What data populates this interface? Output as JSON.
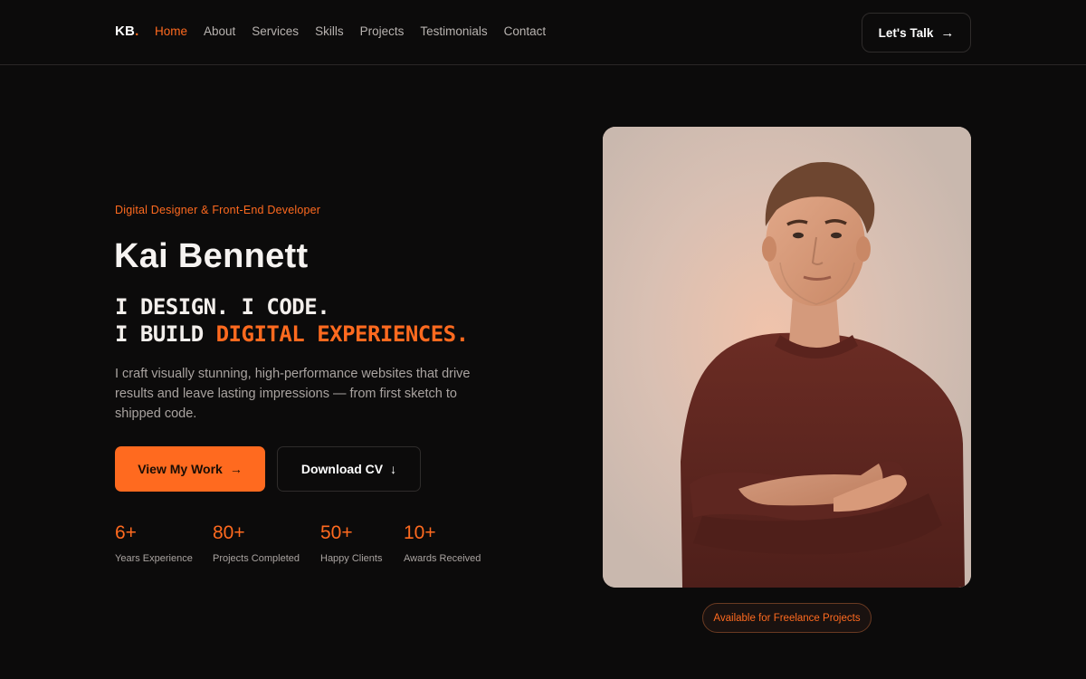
{
  "header": {
    "logo_text": "KB",
    "logo_dot": ".",
    "nav": [
      {
        "label": "Home",
        "active": true
      },
      {
        "label": "About",
        "active": false
      },
      {
        "label": "Services",
        "active": false
      },
      {
        "label": "Skills",
        "active": false
      },
      {
        "label": "Projects",
        "active": false
      },
      {
        "label": "Testimonials",
        "active": false
      },
      {
        "label": "Contact",
        "active": false
      }
    ],
    "cta_label": "Let's Talk",
    "cta_icon": "→"
  },
  "hero": {
    "eyebrow": "Digital Designer & Front-End Developer",
    "name": "Kai Bennett",
    "tagline_line1": "I DESIGN. I CODE.",
    "tagline_line2_prefix": "I BUILD ",
    "tagline_line2_accent": "DIGITAL EXPERIENCES.",
    "description": "I craft visually stunning, high-performance websites that drive results and leave lasting impressions — from first sketch to shipped code.",
    "primary_button": {
      "label": "View My Work",
      "icon": "→"
    },
    "secondary_button": {
      "label": "Download CV",
      "icon": "↓"
    }
  },
  "stats": [
    {
      "value": "6+",
      "label": "Years Experience"
    },
    {
      "value": "80+",
      "label": "Projects Completed"
    },
    {
      "value": "50+",
      "label": "Happy Clients"
    },
    {
      "value": "10+",
      "label": "Awards Received"
    }
  ],
  "portrait": {
    "badge": "Available for Freelance Projects"
  },
  "colors": {
    "accent": "#ff6a1f",
    "background": "#0c0b0b",
    "muted_text": "#a9a3a0"
  }
}
